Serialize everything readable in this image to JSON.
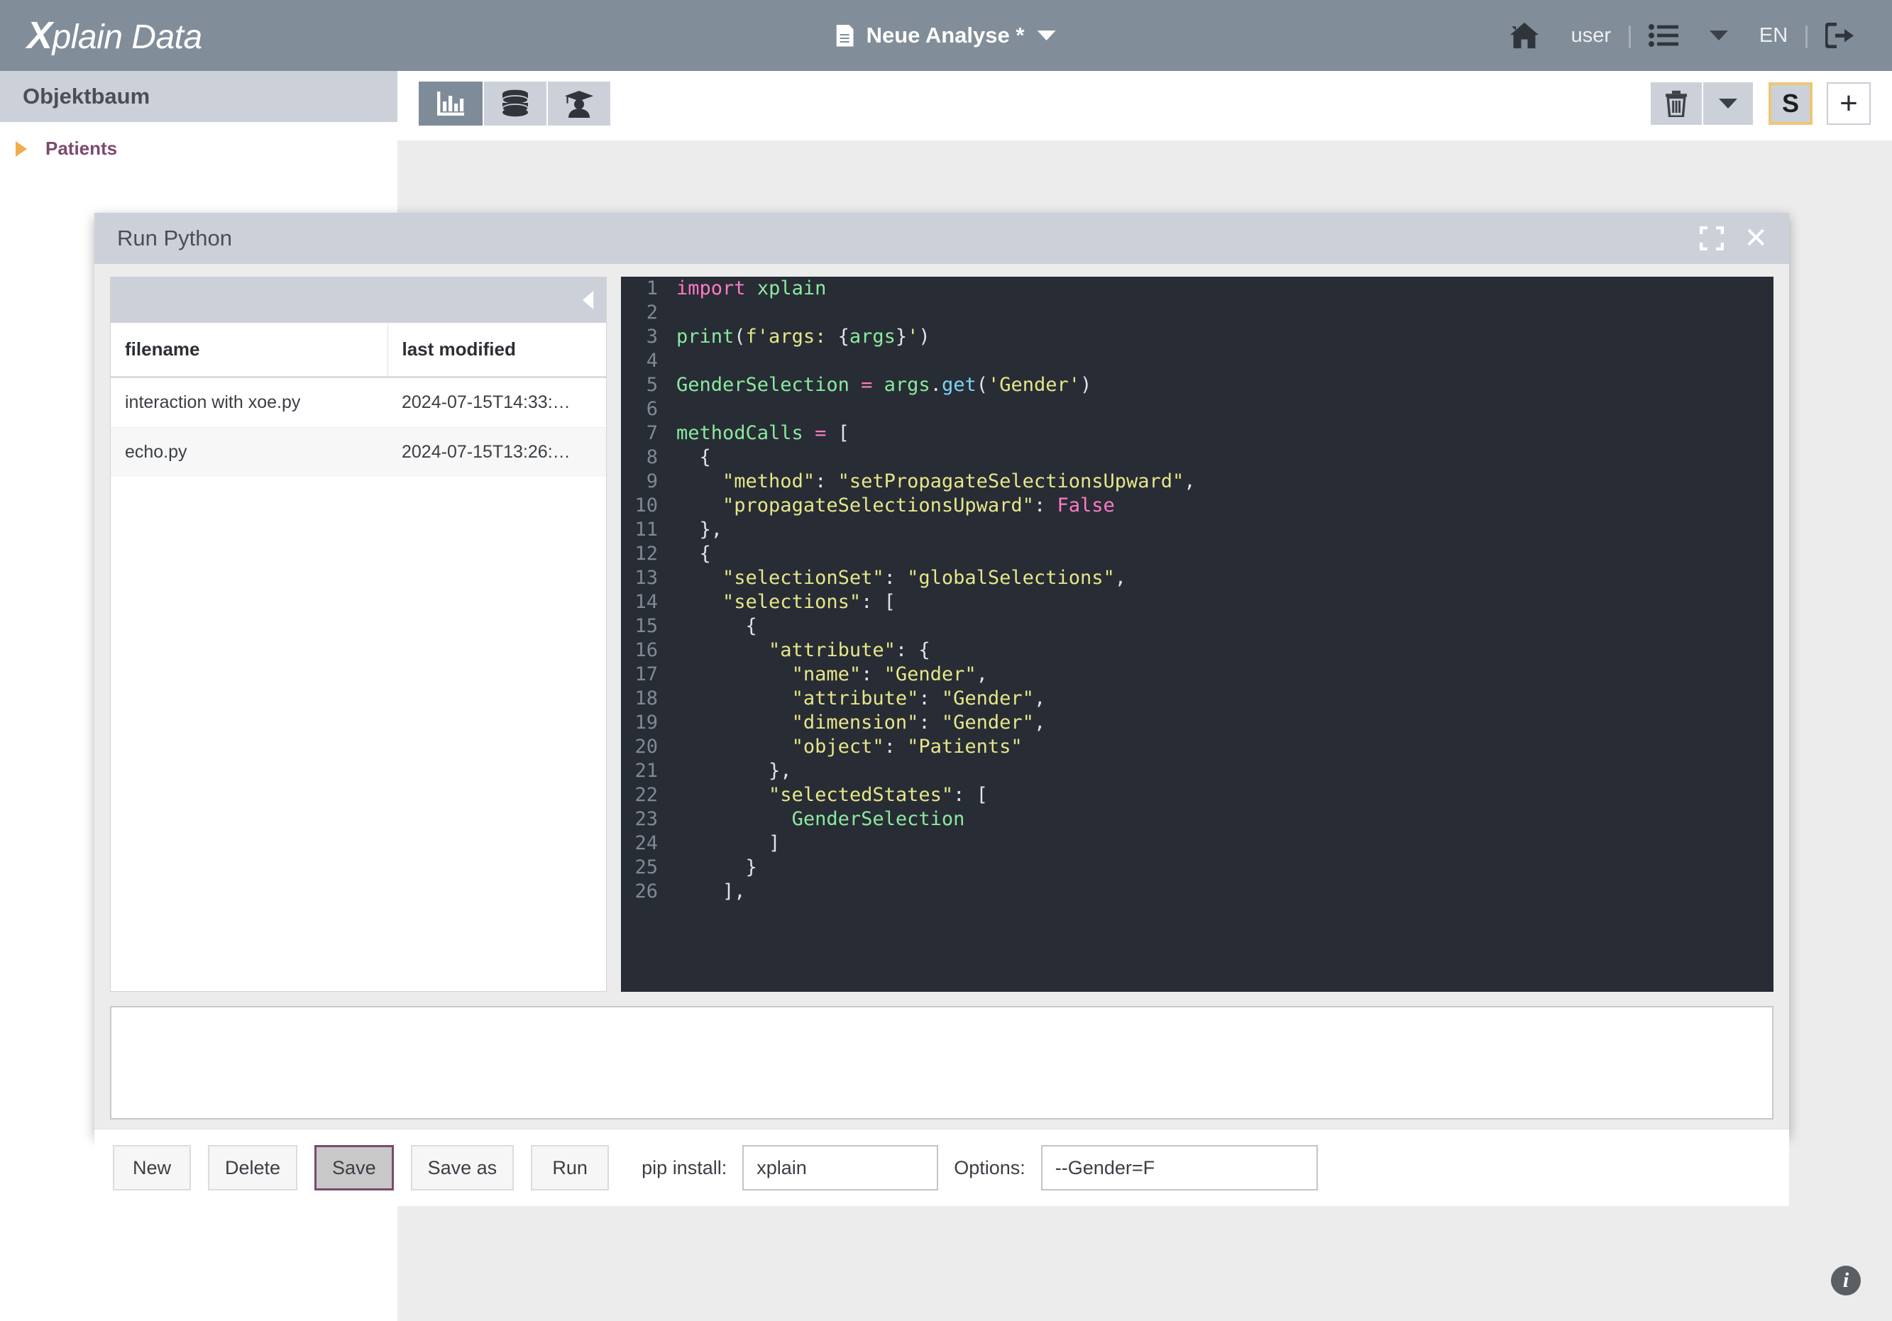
{
  "topbar": {
    "logo_x": "X",
    "logo_rest": "plain Data",
    "doc_title": "Neue Analyse *",
    "user": "user",
    "language": "EN",
    "separator": "|"
  },
  "sidebar": {
    "header": "Objektbaum",
    "items": [
      {
        "label": "Patients"
      }
    ]
  },
  "toolbar": {
    "tabs": [
      {
        "name": "chart-tab"
      },
      {
        "name": "database-tab"
      },
      {
        "name": "training-tab"
      }
    ],
    "s_button": "S",
    "plus_button": "+"
  },
  "dialog": {
    "title": "Run Python",
    "file_table": {
      "columns": [
        "filename",
        "last modified"
      ],
      "rows": [
        {
          "filename": "interaction with xoe.py",
          "modified": "2024-07-15T14:33:…"
        },
        {
          "filename": "echo.py",
          "modified": "2024-07-15T13:26:…"
        }
      ]
    },
    "output": "",
    "footer": {
      "new": "New",
      "delete": "Delete",
      "save": "Save",
      "save_as": "Save as",
      "run": "Run",
      "pip_label": "pip install:",
      "pip_value": "xplain",
      "options_label": "Options:",
      "options_value": "--Gender=F"
    },
    "code": {
      "language": "python",
      "first_visible_line": 1,
      "last_visible_line": 26,
      "lines": [
        {
          "n": 1,
          "tokens": [
            {
              "t": "import",
              "c": "kw"
            },
            {
              "t": " ",
              "c": "code"
            },
            {
              "t": "xplain",
              "c": "nm"
            }
          ]
        },
        {
          "n": 2,
          "tokens": []
        },
        {
          "n": 3,
          "tokens": [
            {
              "t": "print",
              "c": "fn"
            },
            {
              "t": "(",
              "c": "pn"
            },
            {
              "t": "f'args: ",
              "c": "str"
            },
            {
              "t": "{",
              "c": "pn"
            },
            {
              "t": "args",
              "c": "nm"
            },
            {
              "t": "}",
              "c": "pn"
            },
            {
              "t": "'",
              "c": "str"
            },
            {
              "t": ")",
              "c": "pn"
            }
          ]
        },
        {
          "n": 4,
          "tokens": []
        },
        {
          "n": 5,
          "tokens": [
            {
              "t": "GenderSelection",
              "c": "nm"
            },
            {
              "t": " ",
              "c": "code"
            },
            {
              "t": "=",
              "c": "op"
            },
            {
              "t": " ",
              "c": "code"
            },
            {
              "t": "args",
              "c": "nm"
            },
            {
              "t": ".",
              "c": "pn"
            },
            {
              "t": "get",
              "c": "mth"
            },
            {
              "t": "(",
              "c": "pn"
            },
            {
              "t": "'Gender'",
              "c": "str"
            },
            {
              "t": ")",
              "c": "pn"
            }
          ]
        },
        {
          "n": 6,
          "tokens": []
        },
        {
          "n": 7,
          "tokens": [
            {
              "t": "methodCalls",
              "c": "nm"
            },
            {
              "t": " ",
              "c": "code"
            },
            {
              "t": "=",
              "c": "op"
            },
            {
              "t": " ",
              "c": "code"
            },
            {
              "t": "[",
              "c": "pn"
            }
          ]
        },
        {
          "n": 8,
          "tokens": [
            {
              "t": "  {",
              "c": "pn"
            }
          ]
        },
        {
          "n": 9,
          "tokens": [
            {
              "t": "    ",
              "c": "code"
            },
            {
              "t": "\"method\"",
              "c": "str"
            },
            {
              "t": ": ",
              "c": "pn"
            },
            {
              "t": "\"setPropagateSelectionsUpward\"",
              "c": "str"
            },
            {
              "t": ",",
              "c": "pn"
            }
          ]
        },
        {
          "n": 10,
          "tokens": [
            {
              "t": "    ",
              "c": "code"
            },
            {
              "t": "\"propagateSelectionsUpward\"",
              "c": "str"
            },
            {
              "t": ": ",
              "c": "pn"
            },
            {
              "t": "False",
              "c": "kw"
            }
          ]
        },
        {
          "n": 11,
          "tokens": [
            {
              "t": "  },",
              "c": "pn"
            }
          ]
        },
        {
          "n": 12,
          "tokens": [
            {
              "t": "  {",
              "c": "pn"
            }
          ]
        },
        {
          "n": 13,
          "tokens": [
            {
              "t": "    ",
              "c": "code"
            },
            {
              "t": "\"selectionSet\"",
              "c": "str"
            },
            {
              "t": ": ",
              "c": "pn"
            },
            {
              "t": "\"globalSelections\"",
              "c": "str"
            },
            {
              "t": ",",
              "c": "pn"
            }
          ]
        },
        {
          "n": 14,
          "tokens": [
            {
              "t": "    ",
              "c": "code"
            },
            {
              "t": "\"selections\"",
              "c": "str"
            },
            {
              "t": ": ",
              "c": "pn"
            },
            {
              "t": "[",
              "c": "pn"
            }
          ]
        },
        {
          "n": 15,
          "tokens": [
            {
              "t": "      {",
              "c": "pn"
            }
          ]
        },
        {
          "n": 16,
          "tokens": [
            {
              "t": "        ",
              "c": "code"
            },
            {
              "t": "\"attribute\"",
              "c": "str"
            },
            {
              "t": ": ",
              "c": "pn"
            },
            {
              "t": "{",
              "c": "pn"
            }
          ]
        },
        {
          "n": 17,
          "tokens": [
            {
              "t": "          ",
              "c": "code"
            },
            {
              "t": "\"name\"",
              "c": "str"
            },
            {
              "t": ": ",
              "c": "pn"
            },
            {
              "t": "\"Gender\"",
              "c": "str"
            },
            {
              "t": ",",
              "c": "pn"
            }
          ]
        },
        {
          "n": 18,
          "tokens": [
            {
              "t": "          ",
              "c": "code"
            },
            {
              "t": "\"attribute\"",
              "c": "str"
            },
            {
              "t": ": ",
              "c": "pn"
            },
            {
              "t": "\"Gender\"",
              "c": "str"
            },
            {
              "t": ",",
              "c": "pn"
            }
          ]
        },
        {
          "n": 19,
          "tokens": [
            {
              "t": "          ",
              "c": "code"
            },
            {
              "t": "\"dimension\"",
              "c": "str"
            },
            {
              "t": ": ",
              "c": "pn"
            },
            {
              "t": "\"Gender\"",
              "c": "str"
            },
            {
              "t": ",",
              "c": "pn"
            }
          ]
        },
        {
          "n": 20,
          "tokens": [
            {
              "t": "          ",
              "c": "code"
            },
            {
              "t": "\"object\"",
              "c": "str"
            },
            {
              "t": ": ",
              "c": "pn"
            },
            {
              "t": "\"Patients\"",
              "c": "str"
            }
          ]
        },
        {
          "n": 21,
          "tokens": [
            {
              "t": "        },",
              "c": "pn"
            }
          ]
        },
        {
          "n": 22,
          "tokens": [
            {
              "t": "        ",
              "c": "code"
            },
            {
              "t": "\"selectedStates\"",
              "c": "str"
            },
            {
              "t": ": ",
              "c": "pn"
            },
            {
              "t": "[",
              "c": "pn"
            }
          ]
        },
        {
          "n": 23,
          "tokens": [
            {
              "t": "          ",
              "c": "code"
            },
            {
              "t": "GenderSelection",
              "c": "nm"
            }
          ]
        },
        {
          "n": 24,
          "tokens": [
            {
              "t": "        ]",
              "c": "pn"
            }
          ]
        },
        {
          "n": 25,
          "tokens": [
            {
              "t": "      }",
              "c": "pn"
            }
          ]
        },
        {
          "n": 26,
          "tokens": [
            {
              "t": "    ],",
              "c": "pn"
            }
          ]
        }
      ]
    }
  },
  "colors": {
    "topbar_bg": "#818d99",
    "panel_header_bg": "#ccd1d9",
    "accent_orange": "#f0ad4e",
    "accent_purple": "#7b4a6e",
    "editor_bg": "#282c34"
  }
}
